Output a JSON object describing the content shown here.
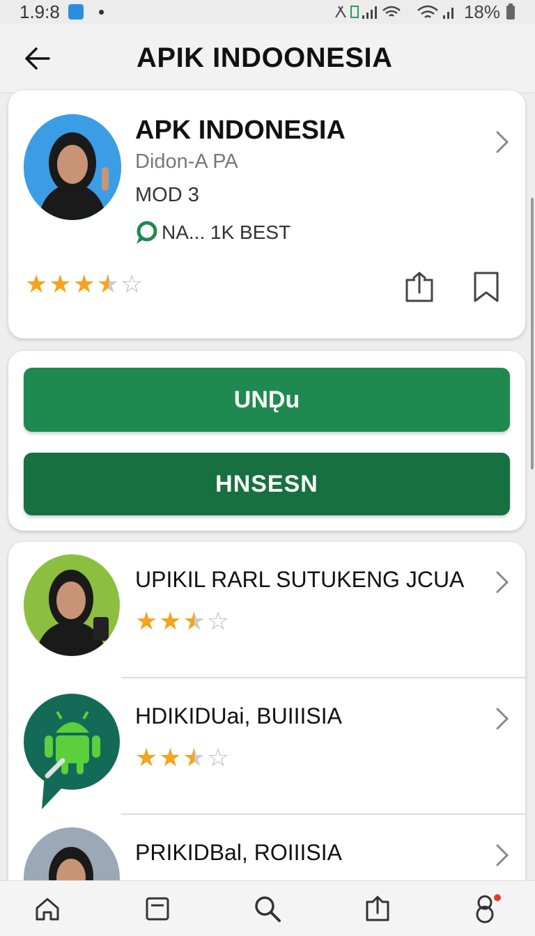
{
  "status_bar": {
    "time": "1.9:8",
    "battery": "18%"
  },
  "app_bar": {
    "title": "APIK INDOONESIA"
  },
  "hero": {
    "app_name": "APK INDONESIA",
    "developer": "Didon-A PA",
    "mod_label": "MOD  3",
    "tag_text": "NA... 1K BEST",
    "rating": 3.5,
    "rating_max": 5
  },
  "actions": {
    "primary_label": "UND̨u",
    "secondary_label": "HNSESN"
  },
  "related": [
    {
      "title": "UPIKIL RARL SUTUKENG JCUA",
      "rating": 2.5,
      "rating_max": 4
    },
    {
      "title": "HDIKIDUai, BUIIISIA",
      "rating": 2.5,
      "rating_max": 4
    },
    {
      "title": "PRIKIDBal, ROIIISIA"
    }
  ],
  "bottom_nav": {
    "items": [
      "home-icon",
      "tabs-icon",
      "search-icon",
      "share-icon",
      "profile-icon"
    ]
  },
  "colors": {
    "primary": "#1f8a4f",
    "secondary": "#17703f",
    "star": "#f4a41d",
    "notification_dot": "#e53935"
  }
}
